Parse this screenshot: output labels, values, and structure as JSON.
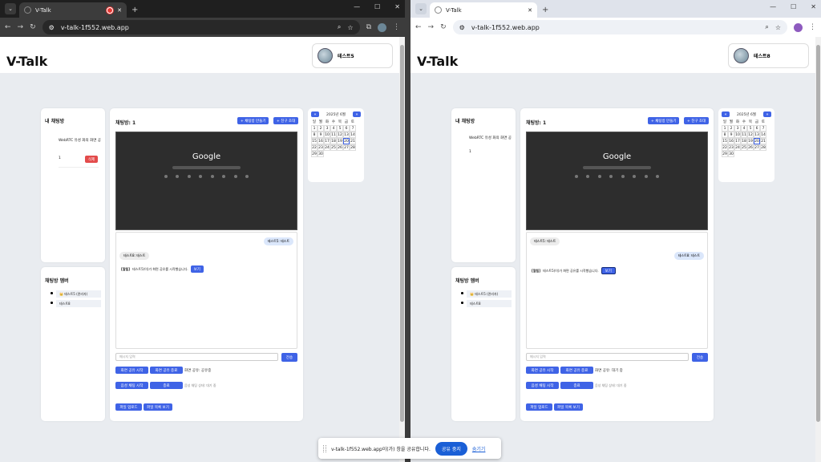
{
  "browser": {
    "tab_title": "V-Talk",
    "url": "v-talk-1f552.web.app",
    "min": "—",
    "max": "☐",
    "close": "✕",
    "new_tab": "+",
    "menu": "⌄"
  },
  "app": {
    "logo": "V-Talk",
    "users": {
      "left": "테스트5",
      "right": "테스트8"
    }
  },
  "rooms_panel": {
    "title": "내 채팅방",
    "item_name": "WebRTC 유성 화의 화면 공",
    "left_item": "1",
    "right_item": "1",
    "delete_label": "삭제"
  },
  "members_panel": {
    "title": "채팅방 멤버",
    "members": [
      "👑 테스트5 (관리자)",
      "테스트8"
    ]
  },
  "chat_panel": {
    "title": "채팅방: 1",
    "create_label": "+ 채팅방 만들기",
    "invite_label": "+ 친구 초대",
    "screen_text": "Google",
    "messages": {
      "me": "테스트5: 테스트",
      "other": "테스트8: 테스트",
      "notice_prefix": "[알림]",
      "notice_text": "테스트5(이)가 화면 공유를 시작했습니다.",
      "view_label": "보기"
    },
    "input_placeholder": "메시지 입력",
    "send_label": "전송",
    "share_start": "화면 공유 시작",
    "share_stop": "화면 공유 종료",
    "share_status_left": "화면 공유: 공유중",
    "share_status_right": "화면 공유: 대기 중",
    "voice_start": "음성 채팅 시작",
    "voice_end": "종료",
    "voice_status": "음성 채팅 상태: 대기 중",
    "file_upload": "파일 업로드",
    "file_list": "파일 목록 보기"
  },
  "calendar": {
    "prev": "«",
    "next": "»",
    "month_label": "2025년 6월",
    "weekdays": [
      "일",
      "월",
      "화",
      "수",
      "목",
      "금",
      "토"
    ],
    "days": [
      "1",
      "2",
      "3",
      "4",
      "5",
      "6",
      "7",
      "8",
      "9",
      "10",
      "11",
      "12",
      "13",
      "14",
      "15",
      "16",
      "17",
      "18",
      "19",
      "20",
      "21",
      "22",
      "23",
      "24",
      "25",
      "26",
      "27",
      "28",
      "29",
      "30"
    ],
    "today": "20"
  },
  "share_bar": {
    "text": "v-talk-1f552.web.app이(가) 창을 공유합니다.",
    "stop_label": "공유 중지",
    "hide_label": "숨기기"
  },
  "colors": {
    "accent": "#3f63e6",
    "danger": "#e34b4b",
    "page_bg": "#e9ecf0"
  }
}
